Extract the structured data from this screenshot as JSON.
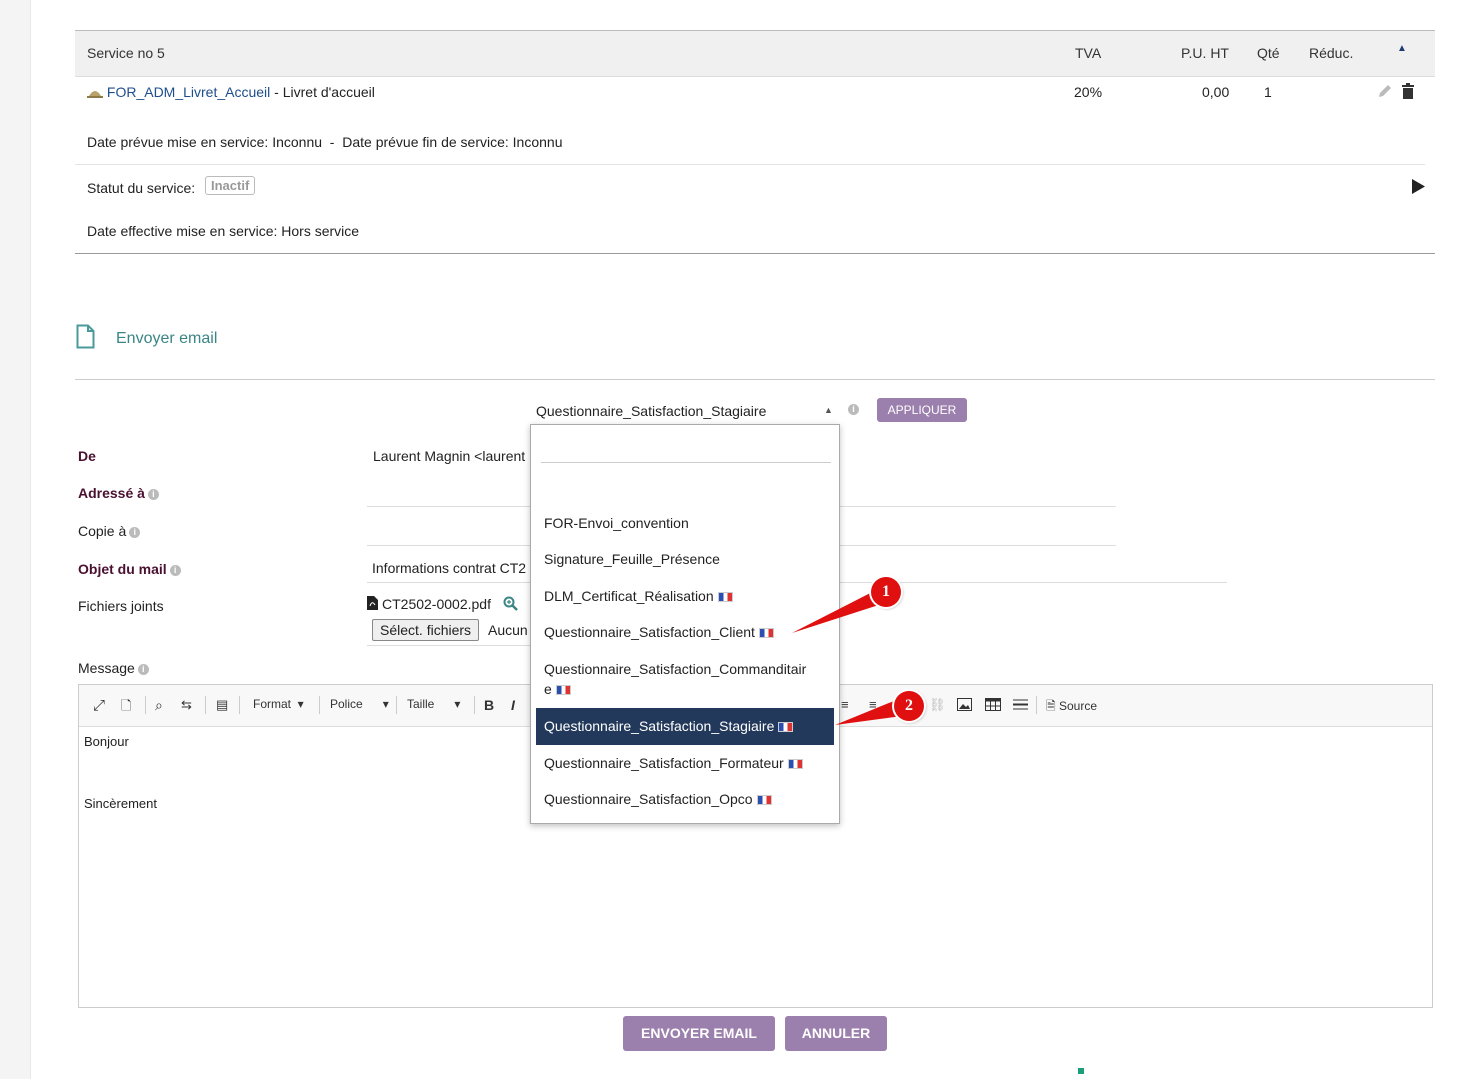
{
  "service": {
    "header": {
      "title": "Service no 5",
      "tva": "TVA",
      "pu_ht": "P.U. HT",
      "qte": "Qté",
      "reduc": "Réduc."
    },
    "row": {
      "code": "FOR_ADM_Livret_Accueil",
      "desc": " - Livret d'accueil",
      "tva": "20%",
      "pu_ht": "0,00",
      "qte": "1"
    },
    "dates_line": "Date prévue mise en service: Inconnu  -  Date prévue fin de service: Inconnu",
    "status_label": "Statut du service:",
    "status_badge": "Inactif",
    "effective_date": "Date effective mise en service: Hors service"
  },
  "email_section": {
    "title": "Envoyer email",
    "template_selected": "Questionnaire_Satisfaction_Stagiaire",
    "apply_button": "APPLIQUER",
    "from_label": "De",
    "from_value": "Laurent Magnin <laurent",
    "to_label": "Adressé à",
    "cc_label": "Copie à",
    "subject_label": "Objet du mail",
    "subject_value": "Informations contrat CT2",
    "attachments_label": "Fichiers joints",
    "attachment_file": "CT2502-0002.pdf",
    "select_files_button": "Sélect. fichiers",
    "no_file_text": "Aucun",
    "message_label": "Message"
  },
  "editor": {
    "toolbar": {
      "format": "Format",
      "font": "Police",
      "size": "Taille",
      "bold": "B",
      "italic": "I",
      "source": "Source"
    },
    "body_line1": "Bonjour",
    "body_line2": "Sincèrement"
  },
  "dropdown": {
    "items": [
      {
        "label": "FOR-Envoi_convention",
        "flag": false
      },
      {
        "label": "Signature_Feuille_Présence",
        "flag": false
      },
      {
        "label": "DLM_Certificat_Réalisation",
        "flag": true
      },
      {
        "label": "Questionnaire_Satisfaction_Client",
        "flag": true
      },
      {
        "label": "Questionnaire_Satisfaction_Commanditair",
        "label_cont": "e",
        "flag": true
      },
      {
        "label": "Questionnaire_Satisfaction_Stagiaire",
        "flag": true,
        "selected": true
      },
      {
        "label": "Questionnaire_Satisfaction_Formateur",
        "flag": true
      },
      {
        "label": "Questionnaire_Satisfaction_Opco",
        "flag": true
      }
    ]
  },
  "callouts": {
    "one": "1",
    "two": "2"
  },
  "buttons": {
    "send": "ENVOYER EMAIL",
    "cancel": "ANNULER"
  },
  "colors": {
    "accent_purple": "#9b7fac",
    "selected_bg": "#23395b",
    "callout_red": "#e01010",
    "link_blue": "#1f4e8c"
  }
}
